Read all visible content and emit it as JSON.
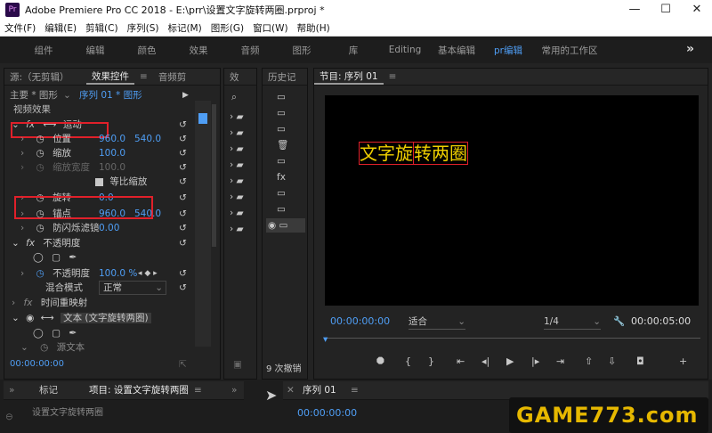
{
  "titlebar": {
    "logo": "Pr",
    "title": "Adobe Premiere Pro CC 2018 - E:\\prr\\设置文字旋转两圈.prproj *",
    "controls": [
      "—",
      "☐",
      "✕"
    ]
  },
  "menu": [
    "文件(F)",
    "编辑(E)",
    "剪辑(C)",
    "序列(S)",
    "标记(M)",
    "图形(G)",
    "窗口(W)",
    "帮助(H)"
  ],
  "workspaces": [
    "组件",
    "编辑",
    "颜色",
    "效果",
    "音频",
    "图形",
    "库",
    "Editing",
    "基本编辑",
    "pr编辑",
    "常用的工作区"
  ],
  "workspace_active": "pr编辑",
  "workspace_more": "»",
  "effect_controls": {
    "tabs": [
      "源:（无剪辑）",
      "效果控件",
      "音频剪"
    ],
    "source_line": "主要 * 图形",
    "seq_line": "序列 01 * 图形",
    "section_video": "视频效果",
    "motion": "运动",
    "props": [
      {
        "label": "位置",
        "v1": "960.0",
        "v2": "540.0"
      },
      {
        "label": "缩放",
        "v1": "100.0",
        "v2": ""
      },
      {
        "label": "缩放宽度",
        "v1": "100.0",
        "v2": ""
      }
    ],
    "uniform_scale": "等比缩放",
    "rotation_label": "旋转",
    "rotation_value": "0.0",
    "anchor_label": "锚点",
    "anchor_v1": "960.0",
    "anchor_v2": "540.0",
    "flicker_label": "防闪烁滤镜",
    "flicker_value": "0.00",
    "opacity_section": "不透明度",
    "opacity_label": "不透明度",
    "opacity_value": "100.0 %",
    "blend_label": "混合模式",
    "blend_value": "正常",
    "time_remap": "时间重映射",
    "text_layer": "文本 (文字旋转两圈)",
    "source_text": "源文本",
    "timecode": "00:00:00:00"
  },
  "effects_panel": {
    "tab": "效"
  },
  "history_panel": {
    "tab": "历史记",
    "footer": "9 次撤销"
  },
  "program_monitor": {
    "tab": "节目: 序列 01",
    "overlay_text_a": "文字旋",
    "overlay_text_b": "转两圈",
    "timecode_left": "00:00:00:00",
    "fit": "适合",
    "resolution": "1/4",
    "timecode_right": "00:00:05:00"
  },
  "bottom": {
    "tab_markers": "标记",
    "tab_project": "项目: 设置文字旋转两圈",
    "seq_tab": "序列 01",
    "project_item": "设置文字旋转两圈",
    "seq_timecode": "00:00:00:00",
    "watermark": "GAME773.com"
  },
  "colors": {
    "accent": "#4f9ef5",
    "highlight": "#e0202a",
    "text_yellow": "#f0d000"
  }
}
